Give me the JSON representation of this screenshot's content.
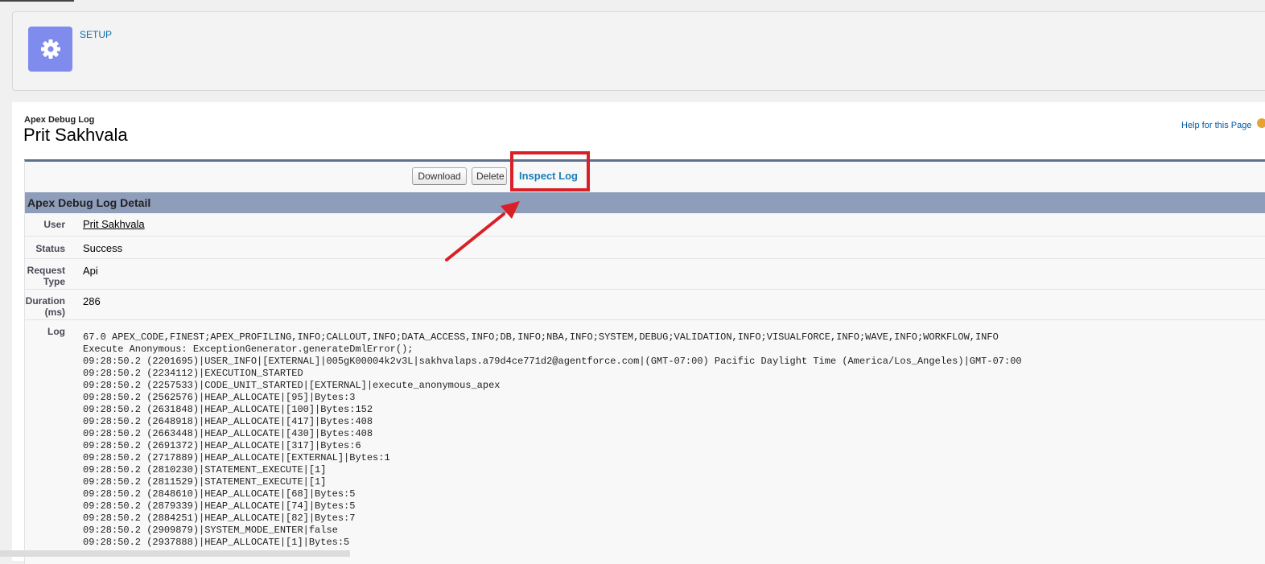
{
  "header": {
    "setup_label": "SETUP"
  },
  "page": {
    "subtitle": "Apex Debug Log",
    "title": "Prit Sakhvala",
    "help_link": "Help for this Page"
  },
  "buttons": {
    "download": "Download",
    "delete": "Delete",
    "inspect_log": "Inspect Log"
  },
  "detail": {
    "section_title": "Apex Debug Log Detail",
    "user_label": "User",
    "user_value": "Prit Sakhvala",
    "status_label": "Status",
    "status_value": "Success",
    "request_type_label_1": "Request",
    "request_type_label_2": "Type",
    "request_type_value": "Api",
    "duration_label_1": "Duration",
    "duration_label_2": "(ms)",
    "duration_value": "286",
    "log_label": "Log",
    "log_lines": [
      "67.0 APEX_CODE,FINEST;APEX_PROFILING,INFO;CALLOUT,INFO;DATA_ACCESS,INFO;DB,INFO;NBA,INFO;SYSTEM,DEBUG;VALIDATION,INFO;VISUALFORCE,INFO;WAVE,INFO;WORKFLOW,INFO",
      "Execute Anonymous: ExceptionGenerator.generateDmlError();",
      "09:28:50.2 (2201695)|USER_INFO|[EXTERNAL]|005gK00004k2v3L|sakhvalaps.a79d4ce771d2@agentforce.com|(GMT-07:00) Pacific Daylight Time (America/Los_Angeles)|GMT-07:00",
      "09:28:50.2 (2234112)|EXECUTION_STARTED",
      "09:28:50.2 (2257533)|CODE_UNIT_STARTED|[EXTERNAL]|execute_anonymous_apex",
      "09:28:50.2 (2562576)|HEAP_ALLOCATE|[95]|Bytes:3",
      "09:28:50.2 (2631848)|HEAP_ALLOCATE|[100]|Bytes:152",
      "09:28:50.2 (2648918)|HEAP_ALLOCATE|[417]|Bytes:408",
      "09:28:50.2 (2663448)|HEAP_ALLOCATE|[430]|Bytes:408",
      "09:28:50.2 (2691372)|HEAP_ALLOCATE|[317]|Bytes:6",
      "09:28:50.2 (2717889)|HEAP_ALLOCATE|[EXTERNAL]|Bytes:1",
      "09:28:50.2 (2810230)|STATEMENT_EXECUTE|[1]",
      "09:28:50.2 (2811529)|STATEMENT_EXECUTE|[1]",
      "09:28:50.2 (2848610)|HEAP_ALLOCATE|[68]|Bytes:5",
      "09:28:50.2 (2879339)|HEAP_ALLOCATE|[74]|Bytes:5",
      "09:28:50.2 (2884251)|HEAP_ALLOCATE|[82]|Bytes:7",
      "09:28:50.2 (2909879)|SYSTEM_MODE_ENTER|false",
      "09:28:50.2 (2937888)|HEAP_ALLOCATE|[1]|Bytes:5"
    ]
  },
  "icons": {
    "setup": "gear-icon",
    "help": "help-icon"
  },
  "colors": {
    "setup_icon_bg": "#7f8ced",
    "section_header_bg": "#8e9dba",
    "highlight": "#d92027",
    "link": "#1a7fb8"
  }
}
